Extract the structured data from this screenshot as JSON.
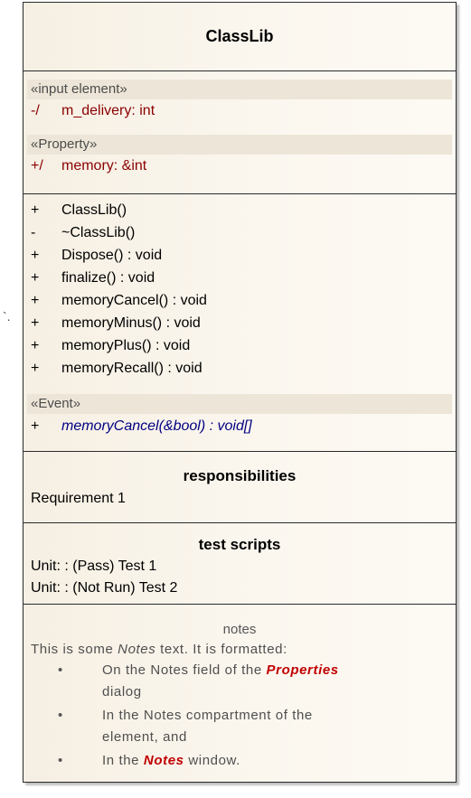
{
  "class_name": "ClassLib",
  "attributes": {
    "groups": [
      {
        "stereotype": "«input element»",
        "items": [
          {
            "visibility": "-/",
            "text": "m_delivery:  int"
          }
        ]
      },
      {
        "stereotype": "«Property»",
        "items": [
          {
            "visibility": "+/",
            "text": "memory:  &int"
          }
        ]
      }
    ]
  },
  "operations": [
    {
      "visibility": "+",
      "text": "ClassLib()"
    },
    {
      "visibility": "-",
      "text": "~ClassLib()"
    },
    {
      "visibility": "+",
      "text": "Dispose() : void"
    },
    {
      "visibility": "+",
      "text": "finalize() : void"
    },
    {
      "visibility": "+",
      "text": "memoryCancel() : void"
    },
    {
      "visibility": "+",
      "text": "memoryMinus() : void"
    },
    {
      "visibility": "+",
      "text": "memoryPlus() : void"
    },
    {
      "visibility": "+",
      "text": "memoryRecall() : void"
    }
  ],
  "events": {
    "stereotype": "«Event»",
    "items": [
      {
        "visibility": "+",
        "text": "memoryCancel(&bool) : void[]"
      }
    ]
  },
  "responsibilities": {
    "heading": "responsibilities",
    "items": [
      "Requirement 1"
    ]
  },
  "test_scripts": {
    "heading": "test scripts",
    "items": [
      "Unit: : (Pass) Test 1",
      "Unit: : (Not Run) Test 2"
    ]
  },
  "notes": {
    "heading": "notes",
    "intro_prefix": "This is some ",
    "intro_emphasis": "Notes",
    "intro_suffix": " text. It is formatted:",
    "bullet_char": "•",
    "bullets": [
      {
        "line1_prefix": "On the Notes field of the ",
        "line1_emphasis": "Properties",
        "line2": "dialog"
      },
      {
        "line1_prefix": "In the Notes compartment of the",
        "line1_emphasis": "",
        "line2": "element, and"
      },
      {
        "line1_prefix": "In the ",
        "line1_emphasis": "Notes",
        "line1_suffix": " window.",
        "line2": ""
      }
    ]
  },
  "connector_glyph": "`.",
  "colors": {
    "attribute_text": "#8b0000",
    "event_text": "#000082",
    "emphasis_red": "#c00000",
    "stereotype_band": "#ede6d8",
    "box_fill": "#f6efe3"
  }
}
